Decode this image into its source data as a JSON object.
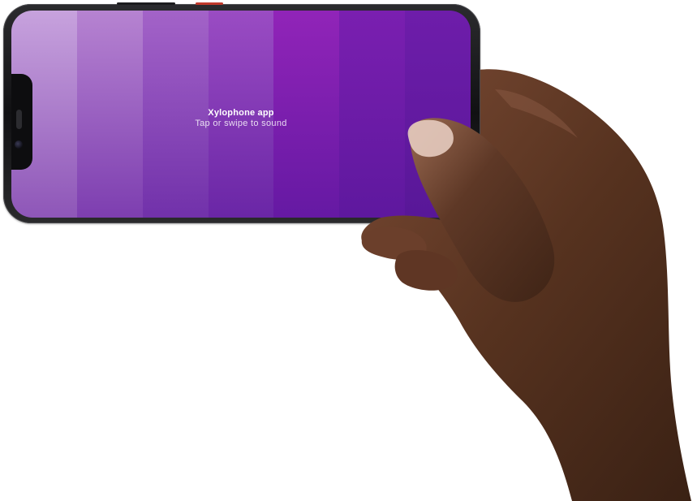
{
  "app": {
    "title": "Xylophone app",
    "subtitle": "Tap or swipe to sound"
  },
  "keys": [
    {
      "label": "key 1",
      "color": "#c7a2dd"
    },
    {
      "label": "key 2",
      "color": "#b683d1"
    },
    {
      "label": "key 3",
      "color": "#a363c8"
    },
    {
      "label": "key 4",
      "color": "#9a4cc3"
    },
    {
      "label": "key 5",
      "color": "#9124b8"
    },
    {
      "label": "key 6",
      "color": "#7a1fb0"
    },
    {
      "label": "key 7",
      "color": "#6e1daa"
    }
  ],
  "device": {
    "frame_color": "#111113",
    "power_button_color": "#c0392b"
  },
  "colors": {
    "accent": "#7a1fb0",
    "skin": "#5a3626"
  },
  "icons": [
    "front-camera-icon",
    "speaker-grille-icon"
  ]
}
